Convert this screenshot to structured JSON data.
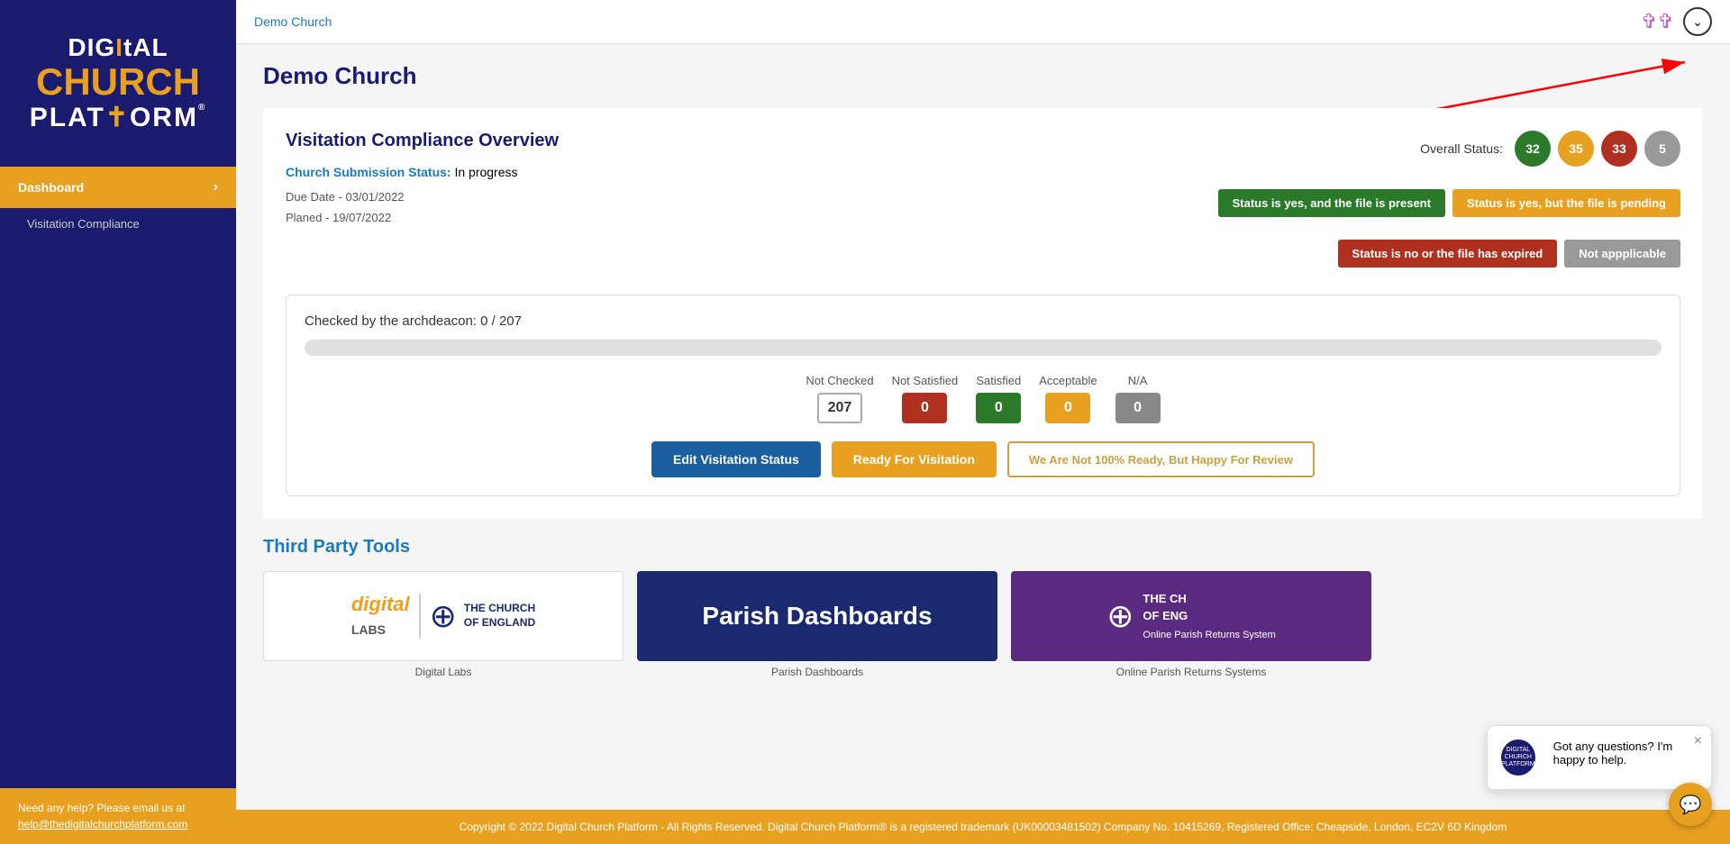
{
  "sidebar": {
    "logo_line1": "DIGItAL",
    "logo_line2": "CHURCH",
    "logo_line3": "PLAtFORM",
    "nav_items": [
      {
        "label": "Dashboard",
        "active": true,
        "has_chevron": true
      },
      {
        "label": "Visitation Compliance",
        "active": false,
        "has_chevron": false
      }
    ],
    "footer_help": "Need any help? Please email us at",
    "footer_email": "help@thedigitalchurchplatform.com"
  },
  "topbar": {
    "breadcrumb": "Demo Church",
    "icon_label": "✞✞",
    "dropdown_icon": "⌄"
  },
  "page": {
    "title": "Demo Church"
  },
  "overview": {
    "section_title": "Visitation Compliance Overview",
    "overall_status_label": "Overall Status:",
    "status_circles": [
      {
        "value": "32",
        "color": "#2a7a2a"
      },
      {
        "value": "35",
        "color": "#e8a020"
      },
      {
        "value": "33",
        "color": "#b03020"
      },
      {
        "value": "5",
        "color": "#999999"
      }
    ],
    "legend": [
      {
        "label": "Status is yes, and the file is present",
        "color": "#2a7a2a"
      },
      {
        "label": "Status is yes, but the file is pending",
        "color": "#e8a020"
      },
      {
        "label": "Status is no or the file has expired",
        "color": "#b03020"
      },
      {
        "label": "Not appplicable",
        "color": "#999999"
      }
    ],
    "submission_label": "Church Submission Status:",
    "submission_value": "In progress",
    "due_date": "Due Date - 03/01/2022",
    "planned_date": "Planed - 19/07/2022"
  },
  "progress": {
    "checked_label": "Checked by the archdeacon: 0 / 207",
    "progress_percent": 0,
    "stats": [
      {
        "label": "Not Checked",
        "value": "207",
        "color": "#ffffff",
        "border": "#aaaaaa",
        "text_color": "#333"
      },
      {
        "label": "Not Satisfied",
        "value": "0",
        "color": "#b03020",
        "border": "#b03020",
        "text_color": "#fff"
      },
      {
        "label": "Satisfied",
        "value": "0",
        "color": "#2a7a2a",
        "border": "#2a7a2a",
        "text_color": "#fff"
      },
      {
        "label": "Acceptable",
        "value": "0",
        "color": "#e8a020",
        "border": "#e8a020",
        "text_color": "#fff"
      },
      {
        "label": "N/A",
        "value": "0",
        "color": "#888888",
        "border": "#888888",
        "text_color": "#fff"
      }
    ],
    "buttons": [
      {
        "label": "Edit Visitation Status",
        "style": "primary"
      },
      {
        "label": "Ready For Visitation",
        "style": "warning"
      },
      {
        "label": "We Are Not 100% Ready, But Happy For Review",
        "style": "outline"
      }
    ]
  },
  "third_party": {
    "title": "Third Party Tools",
    "tools": [
      {
        "name": "Digital Labs - Church of England",
        "type": "white"
      },
      {
        "name": "Parish Dashboards",
        "type": "navy"
      },
      {
        "name": "Online Parish Returns System",
        "type": "purple"
      }
    ],
    "tool_labels": [
      "Digital Labs",
      "Parish Dashboards",
      "Online Parish Returns Systems"
    ]
  },
  "footer": {
    "copyright": "Copyright © 2022 Digital Church Platform - All Rights Reserved. Digital Church Platform® is a registered trademark (UK00003481502) Company No. 10415269, Registered Office: Cheapside, London, EC2V 6D Kingdom"
  },
  "chat": {
    "avatar_text": "DIGITAL CHURCH PLATFORM",
    "message": "Got any questions? I'm happy to help.",
    "close_icon": "×"
  }
}
